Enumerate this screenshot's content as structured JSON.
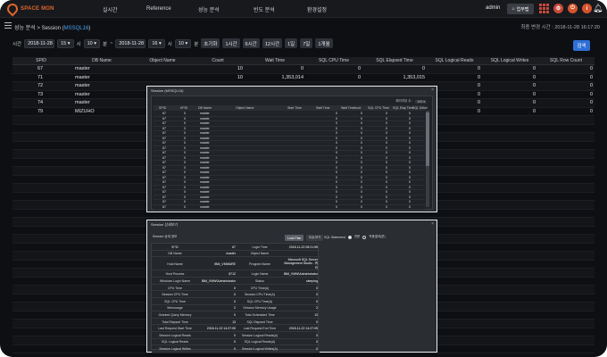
{
  "app": {
    "logo_text": "SPACE MON",
    "nav": [
      "실시간",
      "Reference",
      "성능 분석",
      "빈도 분석",
      "환경설정"
    ],
    "user": "admin",
    "home_button": "업무맵",
    "icons": [
      "grid-icon",
      "settings-icon",
      "power-icon",
      "info-icon",
      "bell-icon"
    ],
    "brand_color": "#e0662b"
  },
  "breadcrumb": {
    "prefix": "성능 분석 > Session (",
    "instance": "MSSQL16",
    "suffix": ")"
  },
  "last_changed": "최종 변경 시간 : 2018-11-28 16:17:20",
  "filter": {
    "time_label": "시간",
    "start_date": "2018-11-28",
    "start_hour": "15",
    "hour_unit": "시",
    "start_min": "10",
    "min_unit": "분",
    "separator": "~",
    "end_date": "2018-11-28",
    "end_hour": "16",
    "end_min": "10",
    "quick": [
      "초기화",
      "1시간",
      "6시간",
      "12시간",
      "1일",
      "7일",
      "1개월"
    ],
    "search": "검색"
  },
  "main_table": {
    "headers": [
      "SPID",
      "DB Name",
      "Object Name",
      "Count",
      "Wait Time",
      "SQL CPU Time",
      "SQL Elapsed Time",
      "SQL Logical Reads",
      "SQL Logical Writes",
      "SQL Row Count"
    ],
    "rows": [
      {
        "spid": "67",
        "db": "master",
        "count": "10",
        "wait": "0",
        "cpu": "0",
        "elapsed": "0",
        "reads": "0",
        "writes": "0",
        "rowcnt": "0"
      },
      {
        "spid": "71",
        "db": "master",
        "count": "10",
        "wait": "1,353,014",
        "cpu": "0",
        "elapsed": "1,353,015",
        "reads": "0",
        "writes": "0",
        "rowcnt": "0"
      },
      {
        "spid": "72",
        "db": "master",
        "count": "",
        "wait": "",
        "cpu": "",
        "elapsed": "",
        "reads": "0",
        "writes": "0",
        "rowcnt": "0"
      },
      {
        "spid": "73",
        "db": "master",
        "count": "",
        "wait": "",
        "cpu": "",
        "elapsed": "",
        "reads": "0",
        "writes": "0",
        "rowcnt": "0"
      },
      {
        "spid": "74",
        "db": "master",
        "count": "",
        "wait": "",
        "cpu": "",
        "elapsed": "",
        "reads": "0",
        "writes": "0",
        "rowcnt": "0"
      },
      {
        "spid": "79",
        "db": "MIZUHO",
        "count": "",
        "wait": "",
        "cpu": "",
        "elapsed": "",
        "reads": "0",
        "writes": "0",
        "rowcnt": "0"
      }
    ]
  },
  "session_modal": {
    "title": "Session (MSSQL16)",
    "close": "×",
    "pager_label": "페이지당 수 :",
    "pager_value": "100",
    "headers": [
      "SPID",
      "KPID",
      "DB Name",
      "Object Name",
      "Start Time",
      "Wait Time",
      "Wait Timeboot",
      "SQL CPU Time",
      "SQL Elap Time",
      "SQL Detail"
    ],
    "rows": [
      [
        "67",
        "0",
        "master",
        "0",
        "0",
        "0",
        "0"
      ],
      [
        "67",
        "0",
        "master",
        "0",
        "0",
        "0",
        "0"
      ],
      [
        "67",
        "0",
        "master",
        "0",
        "0",
        "0",
        "0"
      ],
      [
        "67",
        "0",
        "master",
        "0",
        "0",
        "0",
        "0"
      ],
      [
        "67",
        "0",
        "master",
        "0",
        "0",
        "0",
        "0"
      ],
      [
        "67",
        "0",
        "master",
        "0",
        "0",
        "0",
        "0"
      ],
      [
        "67",
        "0",
        "master",
        "0",
        "0",
        "0",
        "0"
      ],
      [
        "67",
        "0",
        "master",
        "0",
        "0",
        "0",
        "0"
      ],
      [
        "67",
        "0",
        "master",
        "0",
        "0",
        "0",
        "0"
      ],
      [
        "67",
        "0",
        "master",
        "0",
        "0",
        "0",
        "0"
      ],
      [
        "67",
        "0",
        "master",
        "0",
        "0",
        "0",
        "0"
      ],
      [
        "67",
        "0",
        "master",
        "0",
        "0",
        "0",
        "0"
      ],
      [
        "67",
        "0",
        "master",
        "0",
        "0",
        "0",
        "0"
      ],
      [
        "67",
        "0",
        "master",
        "0",
        "0",
        "0",
        "0"
      ],
      [
        "67",
        "0",
        "master",
        "0",
        "0",
        "0",
        "0"
      ],
      [
        "67",
        "0",
        "master",
        "0",
        "0",
        "0",
        "0"
      ],
      [
        "67",
        "0",
        "master",
        "0",
        "0",
        "0",
        "0"
      ],
      [
        "67",
        "0",
        "master",
        "0",
        "0",
        "0",
        "0"
      ],
      [
        "67",
        "0",
        "master",
        "0",
        "0",
        "0",
        "0"
      ],
      [
        "67",
        "0",
        "master",
        "0",
        "0",
        "0",
        "0"
      ]
    ]
  },
  "detail_modal": {
    "title": "Session 상세보기",
    "close": "×",
    "section_label": "Session 상세 정보",
    "tab_active": "Lock Plan",
    "tab_other": "SQL보기",
    "sql_label": "SQL Statement",
    "radio_on": "전문",
    "radio_off": "적용결과(문)",
    "rows": [
      {
        "k1": "SPID",
        "v1": "67",
        "k2": "Login Time",
        "v2": "2018-11-22 08:21:55"
      },
      {
        "k1": "DB Name",
        "v1": "master",
        "k2": "Object Name",
        "v2": ""
      },
      {
        "k1": "Host Name",
        "v1": "IBM_VMWARE",
        "k2": "Program Name",
        "v2": "Microsoft SQL Server Management Studio - 쿼리"
      },
      {
        "k1": "Host Process",
        "v1": "8712",
        "k2": "Login Name",
        "v2": "IBM_VMW\\Administrator"
      },
      {
        "k1": "Windows Login Name",
        "v1": "IBM_VMW\\Administrator",
        "k2": "Status",
        "v2": "sleeping"
      },
      {
        "k1": "CPU Time",
        "v1": "0",
        "k2": "CPU Time(Δ)",
        "v2": "0"
      },
      {
        "k1": "Session CPU Time",
        "v1": "0",
        "k2": "Session CPU Time(Δ)",
        "v2": "0"
      },
      {
        "k1": "SQL CPU Time",
        "v1": "0",
        "k2": "SQL CPU Time(Δ)",
        "v2": "0"
      },
      {
        "k1": "Memusage",
        "v1": "2",
        "k2": "Session Memory Usage",
        "v2": "2"
      },
      {
        "k1": "Granted Query Memory",
        "v1": "0",
        "k2": "Total Scheduled Time",
        "v2": "13"
      },
      {
        "k1": "Total Elapsed Time",
        "v1": "13",
        "k2": "SQL Elapsed Time",
        "v2": "0"
      },
      {
        "k1": "Last Request Start Time",
        "v1": "2018-11-22 14:27:05",
        "k2": "Last Request End Time",
        "v2": "2018-11-22 14:27:05"
      },
      {
        "k1": "Session Logical Reads",
        "v1": "0",
        "k2": "Session Logical Reads(Δ)",
        "v2": "0"
      },
      {
        "k1": "SQL Logical Reads",
        "v1": "0",
        "k2": "SQL Logical Reads(Δ)",
        "v2": "0"
      },
      {
        "k1": "Session Logical Writes",
        "v1": "0",
        "k2": "Session Logical Writes(Δ)",
        "v2": "0"
      }
    ]
  }
}
